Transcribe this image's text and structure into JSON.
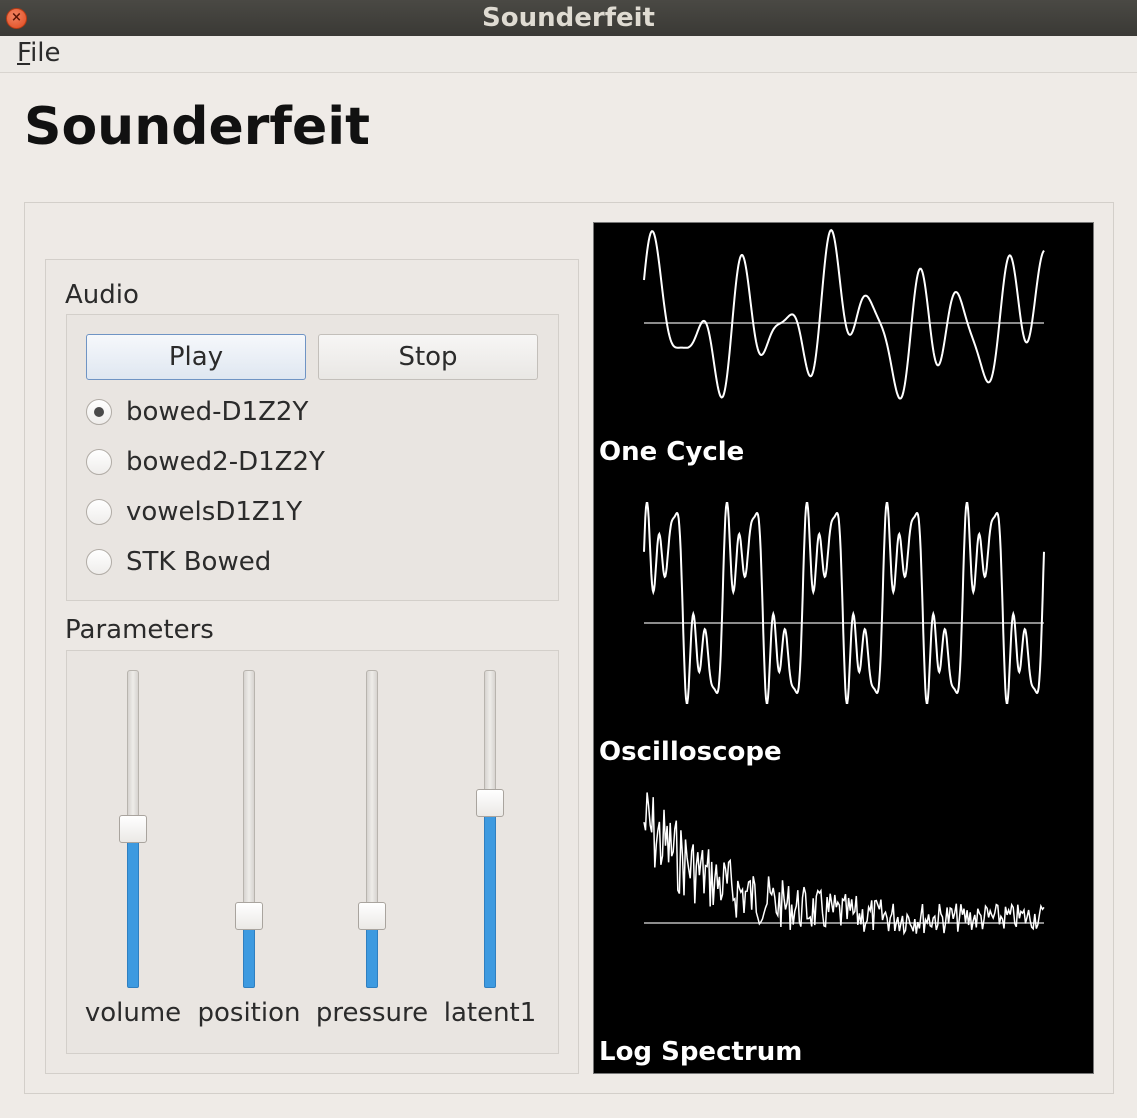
{
  "window": {
    "title": "Sounderfeit"
  },
  "menu": {
    "file": {
      "mnemonic": "F",
      "rest": "ile"
    }
  },
  "heading": "Sounderfeit",
  "audio": {
    "label": "Audio",
    "play_label": "Play",
    "stop_label": "Stop",
    "sources": [
      {
        "label": "bowed-D1Z2Y",
        "checked": true
      },
      {
        "label": "bowed2-D1Z2Y",
        "checked": false
      },
      {
        "label": "vowelsD1Z1Y",
        "checked": false
      },
      {
        "label": "STK Bowed",
        "checked": false
      }
    ]
  },
  "parameters": {
    "label": "Parameters",
    "sliders": [
      {
        "label": "volume",
        "value": 0.5
      },
      {
        "label": "position",
        "value": 0.2
      },
      {
        "label": "pressure",
        "value": 0.2
      },
      {
        "label": "latent1",
        "value": 0.59
      }
    ]
  },
  "visualizations": [
    {
      "title": "One Cycle"
    },
    {
      "title": "Oscilloscope"
    },
    {
      "title": "Log Spectrum"
    }
  ],
  "colors": {
    "accent": "#3d9ae0",
    "viz_bg": "#000000",
    "viz_line": "#ffffff"
  }
}
